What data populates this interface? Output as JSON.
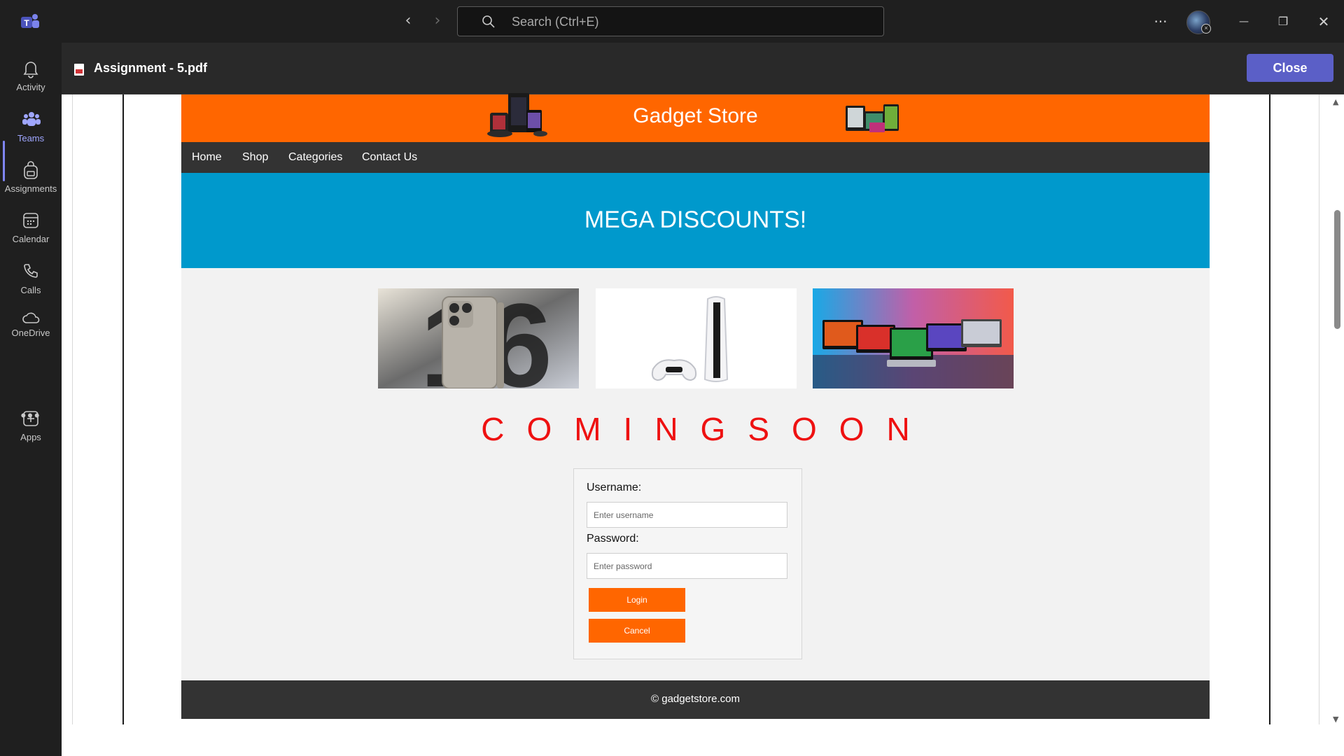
{
  "window": {
    "search_placeholder": "Search (Ctrl+E)",
    "more_label": "···",
    "minimize_label": "—",
    "restore_label": "❐",
    "close_label": "✕",
    "accent": "#5b5fc7"
  },
  "rail": {
    "items": [
      {
        "label": "Activity",
        "icon": "bell-icon"
      },
      {
        "label": "Teams",
        "icon": "teams-icon",
        "active": true
      },
      {
        "label": "Assignments",
        "icon": "backpack-icon"
      },
      {
        "label": "Calendar",
        "icon": "calendar-icon"
      },
      {
        "label": "Calls",
        "icon": "phone-icon"
      },
      {
        "label": "OneDrive",
        "icon": "cloud-icon"
      },
      {
        "label": "Apps",
        "icon": "add-app-icon"
      }
    ],
    "more": "•••"
  },
  "file": {
    "title": "Assignment - 5.pdf",
    "close_label": "Close"
  },
  "site": {
    "title": "Gadget Store",
    "header_color": "#ff6600",
    "nav": [
      "Home",
      "Shop",
      "Categories",
      "Contact Us"
    ],
    "hero_text": "MEGA DISCOUNTS!",
    "hero_color": "#0099cc",
    "products": [
      {
        "name": "phone-16-image"
      },
      {
        "name": "game-console-image"
      },
      {
        "name": "laptops-image"
      }
    ],
    "coming_soon": "COMINGSOON",
    "login": {
      "username_label": "Username:",
      "username_placeholder": "Enter username",
      "password_label": "Password:",
      "password_placeholder": "Enter password",
      "login_button": "Login",
      "cancel_button": "Cancel"
    },
    "footer": "© gadgetstore.com"
  }
}
